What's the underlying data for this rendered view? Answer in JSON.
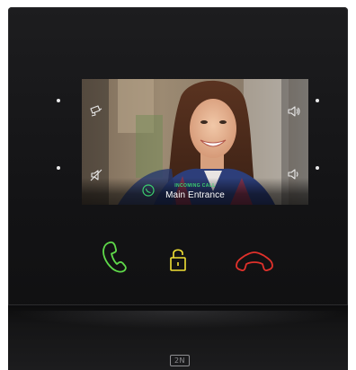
{
  "device": {
    "brand_logo": "2N"
  },
  "screen": {
    "call_status": "INCOMING CALL",
    "call_location": "Main Entrance",
    "icons": {
      "top_left": "camera-icon",
      "bottom_left": "mute-icon",
      "top_right": "volume-up-icon",
      "bottom_right": "volume-down-icon"
    }
  },
  "buttons": {
    "answer": {
      "icon": "phone-answer-icon",
      "color": "#5fd94a"
    },
    "unlock": {
      "icon": "padlock-unlocked-icon",
      "color": "#f2e135"
    },
    "hangup": {
      "icon": "phone-hangup-icon",
      "color": "#e0312b"
    }
  },
  "colors": {
    "status_green": "#3bd16f",
    "device_body": "#151517"
  }
}
